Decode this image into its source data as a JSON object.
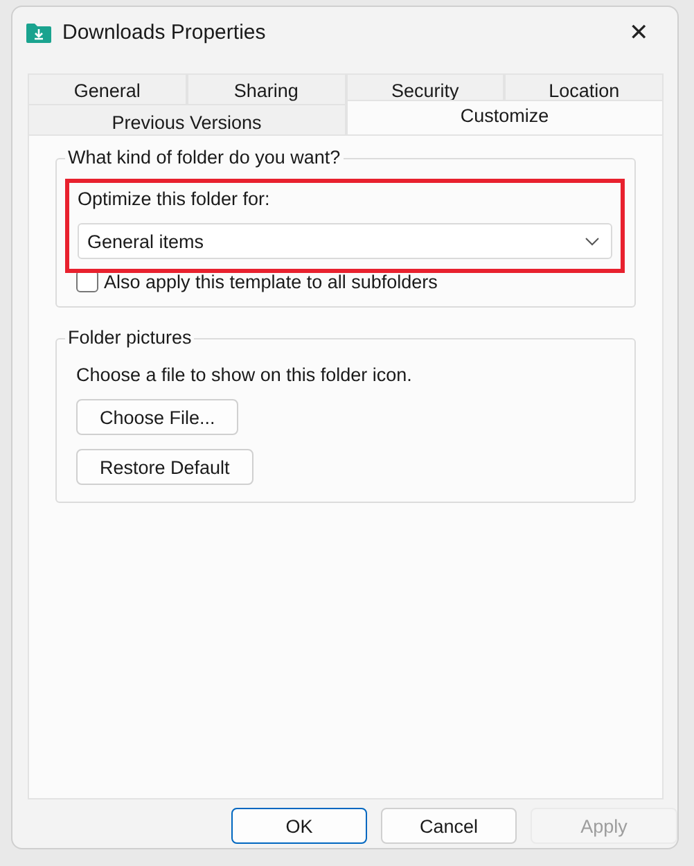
{
  "window": {
    "title": "Downloads Properties",
    "close": "✕"
  },
  "tab_rows": [
    [
      {
        "label": "General",
        "selected": false
      },
      {
        "label": "Sharing",
        "selected": false
      },
      {
        "label": "Security",
        "selected": false
      },
      {
        "label": "Location",
        "selected": false
      }
    ],
    [
      {
        "label": "Previous Versions",
        "selected": false
      },
      {
        "label": "Customize",
        "selected": true
      }
    ]
  ],
  "folder_type": {
    "title": "What kind of folder do you want?",
    "optimize_label": "Optimize this folder for:",
    "dropdown": {
      "value": "General items"
    },
    "highlighted": true,
    "apply_subfolders": {
      "label": "Also apply this template to all subfolders",
      "checked": false
    }
  },
  "folder_pictures": {
    "title": "Folder pictures",
    "description": "Choose a file to show on this folder icon.",
    "buttons": [
      "Choose File...",
      "Restore Default"
    ]
  },
  "buttons": [
    {
      "label": "OK",
      "default": true,
      "disabled": false
    },
    {
      "label": "Cancel",
      "default": false,
      "disabled": false
    },
    {
      "label": "Apply",
      "default": false,
      "disabled": true
    }
  ]
}
